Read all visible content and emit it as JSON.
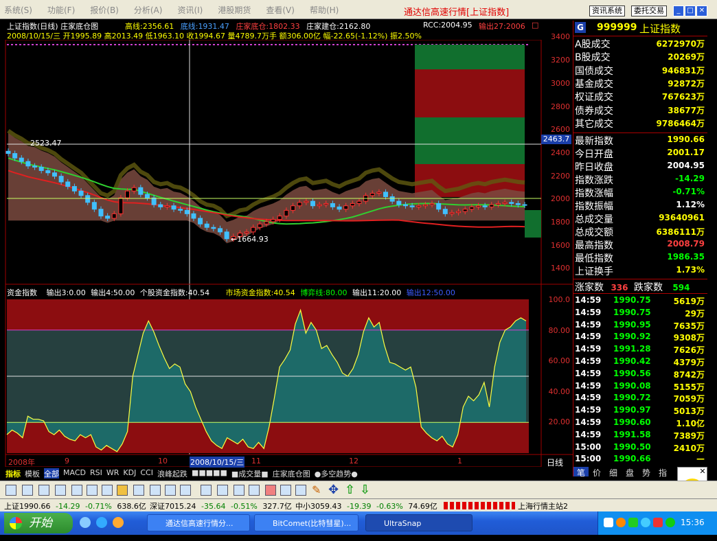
{
  "menu": {
    "items": [
      "系统(S)",
      "功能(F)",
      "报价(B)",
      "分析(A)",
      "资讯(I)",
      "港股期货",
      "查看(V)",
      "帮助(H)"
    ]
  },
  "app": {
    "title": "通达信高速行情[上证指数]",
    "btn_news": "资讯系统",
    "btn_trade": "委托交易"
  },
  "chart_header": {
    "name": "上证指数(日线) 庄家底仓图",
    "high_label": "高线:",
    "high_val": "2356.61",
    "bottom_label": "底线:",
    "bottom_val": "1931.47",
    "dealer_label": "庄家底仓:",
    "dealer_val": "1802.33",
    "build_label": "庄家建仓:",
    "build_val": "2162.80",
    "ohlc_line": "2008/10/15/三 开1995.89 高2013.49 低1963.10 收1994.67 量4789.7万手 额306.00亿 幅-22.65(-1.12%) 振2.50%",
    "rcc": "RCC:2004.95",
    "out27": "输出27:2006",
    "annot_high": "2523.47",
    "annot_low": "←1664.93",
    "cur_price": "2463.7"
  },
  "price_axis": [
    "3400",
    "3200",
    "3000",
    "2800",
    "2600",
    "2400",
    "2200",
    "2000",
    "1800",
    "1600",
    "1400"
  ],
  "indicator_header": {
    "title": "资金指数",
    "out3": "输出3:0.00",
    "out4": "输出4:50.00",
    "stock_idx": "个股资金指数:40.54",
    "market_idx": "市场资金指数:40.54",
    "game_line": "博弈线:80.00",
    "out11": "输出11:20.00",
    "out12": "输出12:50.00"
  },
  "indicator_axis": [
    "100.0",
    "80.00",
    "60.00",
    "40.00",
    "20.00"
  ],
  "date_axis": {
    "items": [
      "2008年",
      "9",
      "10",
      "2008/10/15/三",
      "11",
      "12",
      "1"
    ],
    "label": "日线"
  },
  "panel_tabs": [
    "指标",
    "模板",
    "全部",
    "MACD",
    "RSI",
    "WR",
    "KDJ",
    "CCI",
    "浪峰起跌",
    "■■■■■",
    "■成交量■",
    "庄家底仓图",
    "●多空趋势●"
  ],
  "right_panel": {
    "badge": "G",
    "code": "999999",
    "name": "上证指数",
    "volumes": [
      {
        "label": "A股成交",
        "value": "6272970万"
      },
      {
        "label": "B股成交",
        "value": "20269万"
      },
      {
        "label": "国债成交",
        "value": "946831万"
      },
      {
        "label": "基金成交",
        "value": "92872万"
      },
      {
        "label": "权证成交",
        "value": "767623万"
      },
      {
        "label": "债券成交",
        "value": "38677万"
      },
      {
        "label": "其它成交",
        "value": "9786464万"
      }
    ],
    "stats": [
      {
        "label": "最新指数",
        "value": "1990.66",
        "color": "#ffff00"
      },
      {
        "label": "今日开盘",
        "value": "2001.17",
        "color": "#ffff00"
      },
      {
        "label": "昨日收盘",
        "value": "2004.95",
        "color": "#ffffff"
      },
      {
        "label": "指数涨跌",
        "value": "-14.29",
        "color": "#00ff00"
      },
      {
        "label": "指数涨幅",
        "value": "-0.71%",
        "color": "#00ff00"
      },
      {
        "label": "指数振幅",
        "value": "1.12%",
        "color": "#ffffff"
      },
      {
        "label": "总成交量",
        "value": "93640961",
        "color": "#ffff00"
      },
      {
        "label": "总成交额",
        "value": "6386111万",
        "color": "#ffff00"
      },
      {
        "label": "最高指数",
        "value": "2008.79",
        "color": "#ff4040"
      },
      {
        "label": "最低指数",
        "value": "1986.35",
        "color": "#00ff00"
      },
      {
        "label": "上证换手",
        "value": "1.73%",
        "color": "#ffff00"
      }
    ],
    "up_label": "涨家数",
    "up_count": "336",
    "down_label": "跌家数",
    "down_count": "594",
    "ticks": [
      {
        "time": "14:59",
        "price": "1990.75",
        "vol": "5619万"
      },
      {
        "time": "14:59",
        "price": "1990.75",
        "vol": "29万"
      },
      {
        "time": "14:59",
        "price": "1990.95",
        "vol": "7635万"
      },
      {
        "time": "14:59",
        "price": "1990.92",
        "vol": "9308万"
      },
      {
        "time": "14:59",
        "price": "1991.28",
        "vol": "7626万"
      },
      {
        "time": "14:59",
        "price": "1990.42",
        "vol": "4379万"
      },
      {
        "time": "14:59",
        "price": "1990.56",
        "vol": "8742万"
      },
      {
        "time": "14:59",
        "price": "1990.08",
        "vol": "5155万"
      },
      {
        "time": "14:59",
        "price": "1990.72",
        "vol": "7059万"
      },
      {
        "time": "14:59",
        "price": "1990.97",
        "vol": "5013万"
      },
      {
        "time": "14:59",
        "price": "1990.60",
        "vol": "1.10亿"
      },
      {
        "time": "14:59",
        "price": "1991.58",
        "vol": "7389万"
      },
      {
        "time": "15:00",
        "price": "1990.50",
        "vol": "2410万"
      },
      {
        "time": "15:00",
        "price": "1990.66",
        "vol": "—"
      }
    ],
    "bottom_tabs": [
      "笔",
      "价",
      "细",
      "盘",
      "势",
      "指"
    ]
  },
  "status": {
    "sh": "上证1990.66",
    "sh_chg": "-14.29",
    "sh_pct": "-0.71%",
    "sh_amt": "638.6亿",
    "sz": "深证7015.24",
    "sz_chg": "-35.64",
    "sz_pct": "-0.51%",
    "sz_amt": "327.7亿",
    "zx": "中小3059.43",
    "zx_chg": "-19.39",
    "zx_pct": "-0.63%",
    "zx_amt": "74.69亿",
    "server": "上海行情主站2"
  },
  "taskbar": {
    "start": "开始",
    "tasks": [
      "通达信高速行情分...",
      "BitComet(比特彗星)...",
      "UltraSnap"
    ],
    "clock": "15:36"
  },
  "chart_data": {
    "type": "candlestick",
    "x_axis_labels": [
      "2008年",
      "9",
      "10",
      "2008/10/15/三",
      "11",
      "12",
      "1"
    ],
    "ylim": [
      1300,
      3450
    ],
    "y_ticks": [
      3400,
      3200,
      3000,
      2800,
      2600,
      2400,
      2200,
      2000,
      1800,
      1600,
      1400
    ],
    "annotations": {
      "high": 2523.47,
      "low": 1664.93,
      "current": 2463.7
    },
    "series": [
      {
        "name": "庄家底仓",
        "values": [
          1802.33
        ]
      },
      {
        "name": "庄家建仓",
        "values": [
          2162.8
        ]
      },
      {
        "name": "高线",
        "values": [
          2356.61
        ]
      },
      {
        "name": "底线",
        "values": [
          1931.47
        ]
      }
    ],
    "close": [
      2450,
      2410,
      2380,
      2340,
      2330,
      2300,
      2280,
      2250,
      2200,
      2160,
      2120,
      2080,
      2020,
      1960,
      1900,
      1880,
      1920,
      2060,
      2120,
      2150,
      2090,
      2060,
      2000,
      1980,
      1990,
      1960,
      1950,
      1920,
      1880,
      1830,
      1800,
      1790,
      1760,
      1700,
      1720,
      1750,
      1760,
      1800,
      1830,
      1850,
      1870,
      1900,
      1950,
      1990,
      2020,
      2030,
      1990,
      2000,
      2010,
      1980,
      1960,
      1990,
      2010,
      2030,
      2080,
      2100,
      2110,
      2070,
      2030,
      2000,
      1990,
      1980,
      1990,
      2000,
      2010,
      1960,
      1920,
      1930,
      1940,
      1960,
      1980,
      1990,
      1980,
      2000,
      2010,
      2020,
      2010,
      2000,
      1995
    ],
    "indicator": {
      "name": "市场资金指数",
      "ylim": [
        0,
        100
      ],
      "levels": [
        80,
        50,
        20
      ],
      "values": [
        12,
        15,
        13,
        10,
        24,
        22,
        22,
        21,
        14,
        12,
        15,
        11,
        9,
        8,
        12,
        10,
        12,
        4,
        2,
        5,
        3,
        1,
        6,
        14,
        50,
        64,
        78,
        86,
        79,
        70,
        62,
        55,
        58,
        56,
        45,
        40,
        30,
        22,
        14,
        8,
        5,
        3,
        10,
        8,
        6,
        9,
        4,
        3,
        7,
        3,
        17,
        36,
        56,
        61,
        67,
        84,
        93,
        78,
        85,
        80,
        68,
        70,
        64,
        59,
        52,
        50,
        55,
        64,
        79,
        88,
        82,
        85,
        70,
        59,
        58,
        56,
        54,
        56,
        43,
        17,
        13,
        10,
        8,
        11,
        6,
        4,
        12,
        30,
        37,
        34,
        38,
        46,
        30,
        56,
        72,
        80,
        82,
        86,
        88,
        86
      ]
    }
  }
}
